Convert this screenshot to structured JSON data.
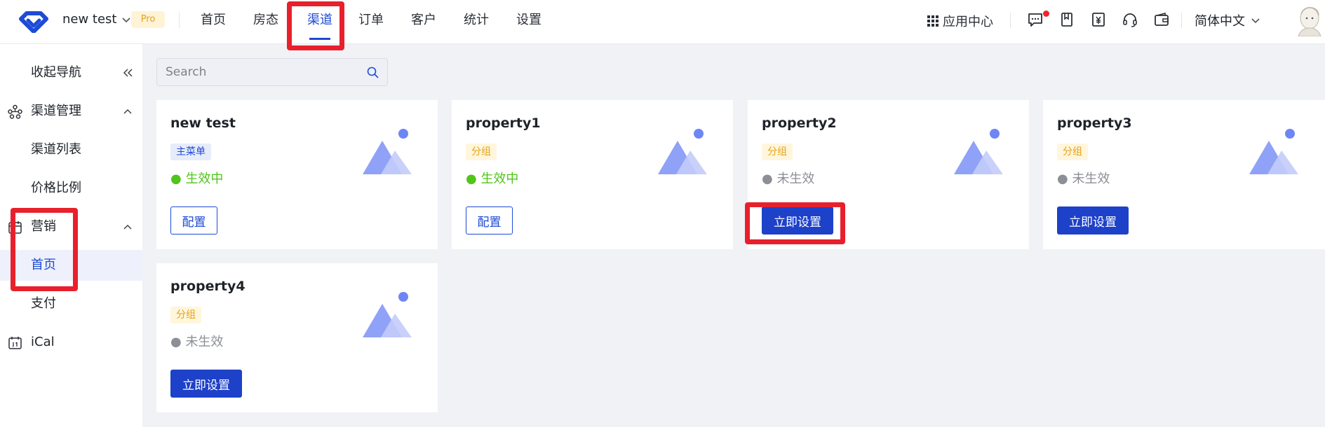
{
  "header": {
    "workspace": "new test",
    "badge": "Pro",
    "nav": [
      {
        "label": "首页"
      },
      {
        "label": "房态"
      },
      {
        "label": "渠道"
      },
      {
        "label": "订单"
      },
      {
        "label": "客户"
      },
      {
        "label": "统计"
      },
      {
        "label": "设置"
      }
    ],
    "active_nav": "渠道",
    "app_center": "应用中心",
    "language": "简体中文"
  },
  "sidebar": {
    "collapse": "收起导航",
    "items": [
      {
        "label": "渠道管理",
        "icon": "network-icon"
      },
      {
        "label": "渠道列表"
      },
      {
        "label": "价格比例"
      },
      {
        "label": "营销",
        "icon": "calendar-icon"
      },
      {
        "label": "首页"
      },
      {
        "label": "支付"
      },
      {
        "label": "iCal",
        "icon": "ical-icon"
      }
    ],
    "active_item": "首页"
  },
  "search": {
    "placeholder": "Search"
  },
  "cards": [
    {
      "title": "new test",
      "tag": "主菜单",
      "status": "生效中",
      "action": "配置"
    },
    {
      "title": "property1",
      "tag": "分组",
      "status": "生效中",
      "action": "配置"
    },
    {
      "title": "property2",
      "tag": "分组",
      "status": "未生效",
      "action": "立即设置"
    },
    {
      "title": "property3",
      "tag": "分组",
      "status": "未生效",
      "action": "立即设置"
    },
    {
      "title": "property4",
      "tag": "分组",
      "status": "未生效",
      "action": "立即设置"
    }
  ],
  "colors": {
    "primary": "#1d4bd6",
    "active_status": "#52c41a",
    "inactive_status": "#8c8f96",
    "annotation": "#e8202c",
    "badge_bg": "#fff3d6",
    "badge_text": "#e5a21a"
  }
}
